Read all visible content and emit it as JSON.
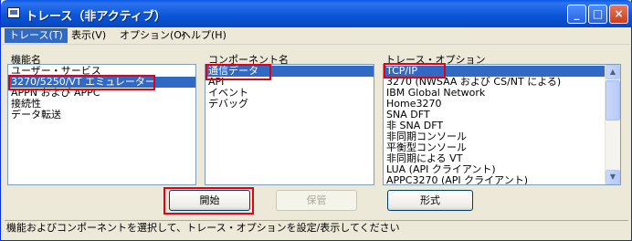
{
  "window": {
    "title": "トレース（非アクティブ）"
  },
  "menu": [
    "トレース(T)",
    "表示(V)",
    "オプション(O)",
    "ヘルプ(H)"
  ],
  "sections": {
    "functions_label": "機能名",
    "components_label": "コンポーネント名",
    "options_label": "トレース・オプション"
  },
  "functions": [
    "ユーザー・サービス",
    "3270/5250/VT エミュレーター",
    "APPN および APPC",
    "接続性",
    "データ転送"
  ],
  "components": [
    "通信データ",
    "API",
    "イベント",
    "デバッグ"
  ],
  "options": [
    "TCP/IP",
    "3270 (NWSAA および CS/NT による)",
    "IBM Global Network",
    "Home3270",
    "SNA DFT",
    "非 SNA DFT",
    "非同期コンソール",
    "平衡型コンソール",
    "非同期による VT",
    "LUA (API クライアント)",
    "APPC3270 (API クライアント)"
  ],
  "buttons": {
    "start": "開始",
    "save": "保管",
    "format": "形式"
  },
  "status": "機能およびコンポーネントを選択して、トレース・オプションを設定/表示してください",
  "colors": {
    "selection": "#316ac5",
    "highlight_box": "#e60012",
    "titlebar": "#0a5ae6"
  }
}
